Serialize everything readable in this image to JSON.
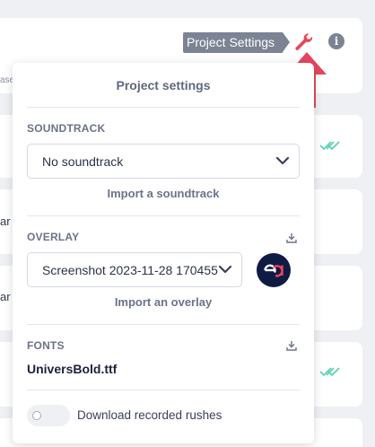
{
  "background": {
    "fragment_ase": "ase",
    "row_fragments": [
      "ar",
      "ar"
    ]
  },
  "header": {
    "tooltip_label": "Project Settings",
    "wrench_icon": "wrench-icon",
    "info_icon_glyph": "i",
    "accent_color": "#e8455a"
  },
  "popover": {
    "title": "Project settings",
    "soundtrack": {
      "label": "SOUNDTRACK",
      "selected": "No soundtrack",
      "import_link": "Import a soundtrack"
    },
    "overlay": {
      "label": "OVERLAY",
      "selected": "Screenshot 2023-11-28 170455",
      "import_link": "Import an overlay"
    },
    "fonts": {
      "label": "FONTS",
      "font_file": "UniversBold.ttf"
    },
    "download_rushes": {
      "label": "Download recorded rushes",
      "enabled": false
    }
  }
}
